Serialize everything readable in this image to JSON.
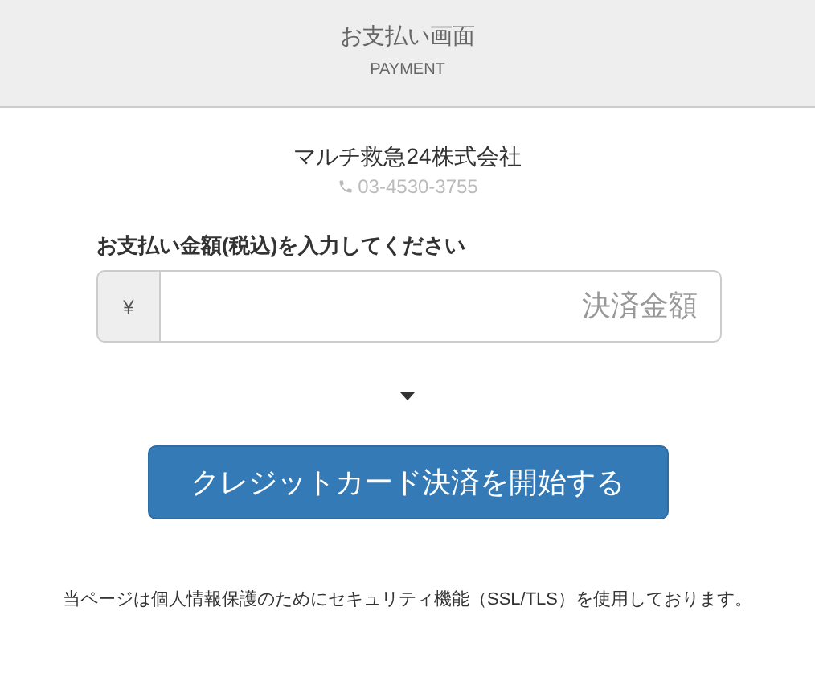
{
  "header": {
    "title": "お支払い画面",
    "subtitle": "PAYMENT"
  },
  "company": {
    "name": "マルチ救急24株式会社",
    "phone": "03-4530-3755"
  },
  "amount": {
    "label": "お支払い金額(税込)を入力してください",
    "prefix": "¥",
    "placeholder": "決済金額"
  },
  "submit_button": "クレジットカード決済を開始する",
  "footer_note": "当ページは個人情報保護のためにセキュリティ機能（SSL/TLS）を使用しております。"
}
